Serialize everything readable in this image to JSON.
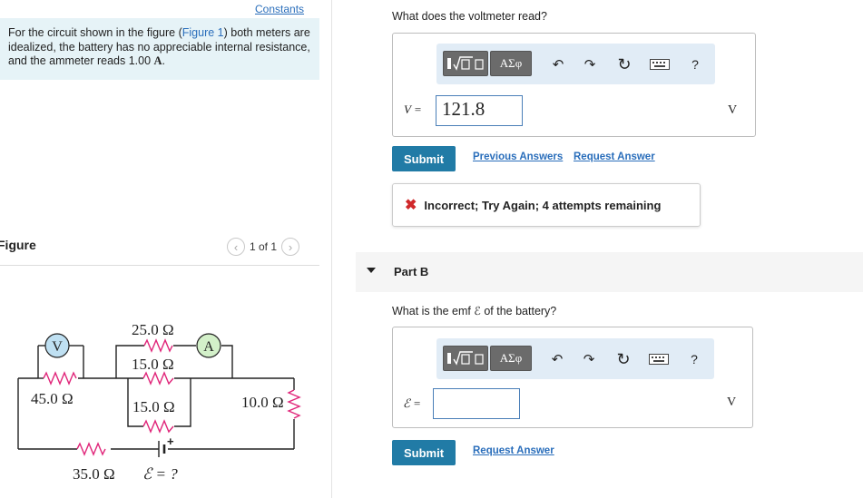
{
  "left": {
    "constants_link": "Constants",
    "problem_pre": "For the circuit shown in the figure (",
    "figure_link": "Figure 1",
    "problem_post": ") both meters are idealized, the battery has no appreciable internal resistance, and the ammeter reads 1.00 ",
    "problem_unit": "A",
    "problem_end": ".",
    "figure_title": "Figure",
    "figure_nav": "1 of 1"
  },
  "circuit": {
    "voltmeter": "V",
    "ammeter": "A",
    "r_top": "25.0 Ω",
    "r_mid_upper": "15.0 Ω",
    "r_mid_lower": "15.0 Ω",
    "r_left": "45.0 Ω",
    "r_right": "10.0 Ω",
    "r_bottom": "35.0 Ω",
    "battery_plus": "+",
    "emf": "ℰ = ?"
  },
  "partA": {
    "question": "What does the voltmeter read?",
    "var_label": "V =",
    "input_value": "121.8",
    "unit": "V",
    "submit": "Submit",
    "previous_answers": "Previous Answers",
    "request_answer": "Request Answer",
    "feedback_icon": "✖",
    "feedback": "Incorrect; Try Again; 4 attempts remaining"
  },
  "partB": {
    "label": "Part B",
    "question": "What is the emf ℰ of the battery?",
    "var_label": "ℰ =",
    "input_value": "",
    "unit": "V",
    "submit": "Submit",
    "request_answer": "Request Answer"
  },
  "toolbar": {
    "greek": "ΑΣφ",
    "help": "?"
  }
}
